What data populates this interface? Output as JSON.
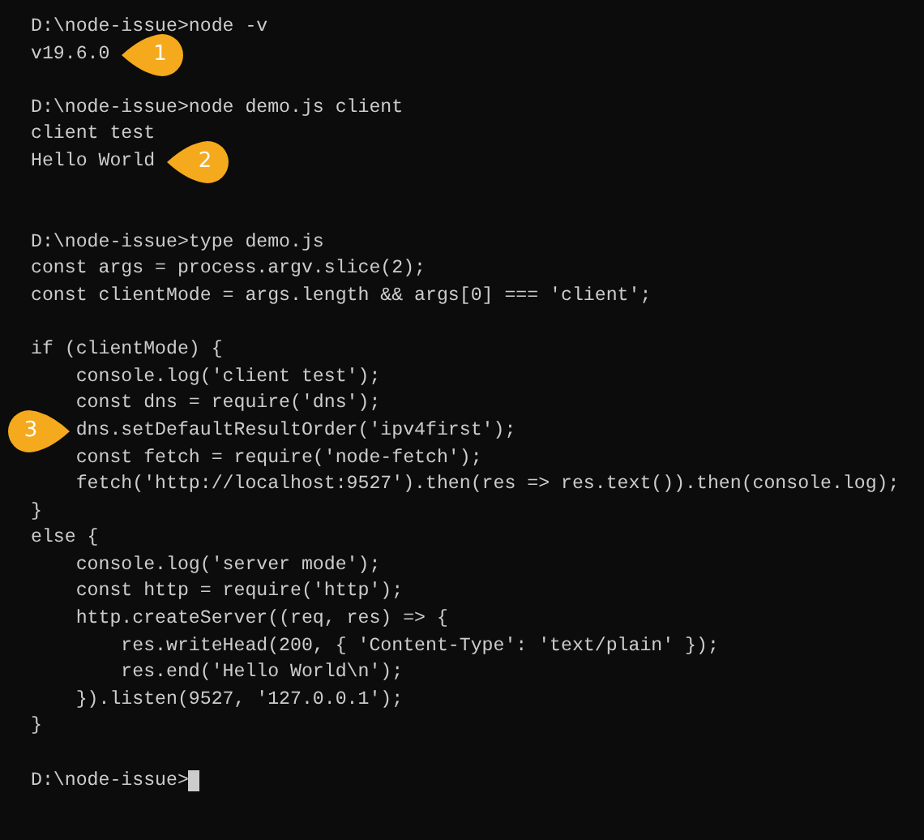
{
  "terminal": {
    "lines": [
      {
        "kind": "line",
        "text": "D:\\node-issue>node -v"
      },
      {
        "kind": "line",
        "text": "v19.6.0",
        "callout": {
          "label": "1",
          "kind": "trailing"
        }
      },
      {
        "kind": "blank"
      },
      {
        "kind": "line",
        "text": "D:\\node-issue>node demo.js client"
      },
      {
        "kind": "line",
        "text": "client test"
      },
      {
        "kind": "line",
        "text": "Hello World",
        "callout": {
          "label": "2",
          "kind": "trailing"
        }
      },
      {
        "kind": "blank"
      },
      {
        "kind": "blank"
      },
      {
        "kind": "line",
        "text": "D:\\node-issue>type demo.js"
      },
      {
        "kind": "line",
        "text": "const args = process.argv.slice(2);"
      },
      {
        "kind": "line",
        "text": "const clientMode = args.length && args[0] === 'client';"
      },
      {
        "kind": "blank"
      },
      {
        "kind": "line",
        "text": "if (clientMode) {"
      },
      {
        "kind": "line",
        "text": "    console.log('client test');"
      },
      {
        "kind": "line",
        "text": "    const dns = require('dns');"
      },
      {
        "kind": "line",
        "text": "    dns.setDefaultResultOrder('ipv4first');",
        "callout": {
          "label": "3",
          "kind": "leading"
        }
      },
      {
        "kind": "line",
        "text": "    const fetch = require('node-fetch');"
      },
      {
        "kind": "line",
        "text": "    fetch('http://localhost:9527').then(res => res.text()).then(console.log);"
      },
      {
        "kind": "line",
        "text": "}"
      },
      {
        "kind": "line",
        "text": "else {"
      },
      {
        "kind": "line",
        "text": "    console.log('server mode');"
      },
      {
        "kind": "line",
        "text": "    const http = require('http');"
      },
      {
        "kind": "line",
        "text": "    http.createServer((req, res) => {"
      },
      {
        "kind": "line",
        "text": "        res.writeHead(200, { 'Content-Type': 'text/plain' });"
      },
      {
        "kind": "line",
        "text": "        res.end('Hello World\\n');"
      },
      {
        "kind": "line",
        "text": "    }).listen(9527, '127.0.0.1');"
      },
      {
        "kind": "line",
        "text": "}"
      },
      {
        "kind": "blank"
      },
      {
        "kind": "line",
        "text": "D:\\node-issue>",
        "cursor": true
      }
    ]
  }
}
